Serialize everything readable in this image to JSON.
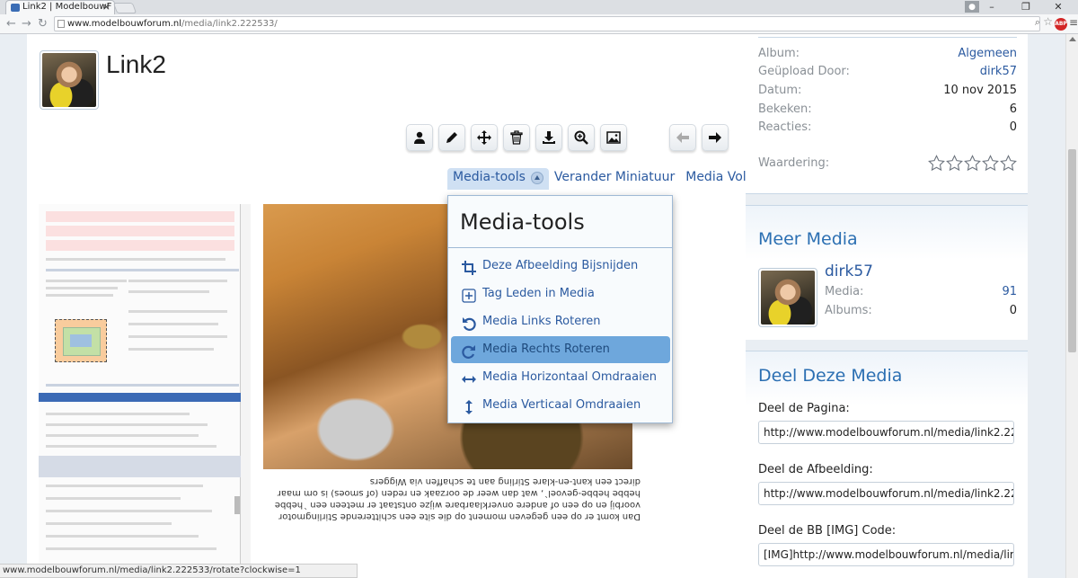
{
  "browser": {
    "tab_title": "Link2 | ModelbouwF",
    "url_host": "www.modelbouwforum.nl",
    "url_path": "/media/link2.222533/",
    "abp_label": "ABP",
    "status_url": "www.modelbouwforum.nl/media/link2.222533/rotate?clockwise=1"
  },
  "media": {
    "title": "Link2",
    "toolbar_icons": [
      "user-icon",
      "pencil-icon",
      "move-icon",
      "trash-icon",
      "download-icon",
      "zoom-icon",
      "image-icon",
      "arrow-left-icon",
      "arrow-right-icon"
    ],
    "tabs": {
      "media_tools": "Media-tools",
      "change_thumb": "Verander Miniatuur",
      "follow": "Media Volgen"
    },
    "photo_caption": "Dan komt er op een gegeven moment op die site een schitterende Stirlingmotor voorbij en op een of andere onverklaarbare wijze ontstaat er meteen een `hebbe hebbe hebbe-gevoel`, wat dan weer de oorzaak en reden (of smoes) is om maar direct een kant-en-klare Stirling aan te schaffen via Wiggers"
  },
  "dropdown": {
    "header": "Media-tools",
    "items": [
      {
        "label": "Deze Afbeelding Bijsnijden",
        "icon": "crop-icon"
      },
      {
        "label": "Tag Leden in Media",
        "icon": "tag-plus-icon"
      },
      {
        "label": "Media Links Roteren",
        "icon": "rotate-left-icon"
      },
      {
        "label": "Media Rechts Roteren",
        "icon": "rotate-right-icon"
      },
      {
        "label": "Media Horizontaal Omdraaien",
        "icon": "flip-horizontal-icon"
      },
      {
        "label": "Media Verticaal Omdraaien",
        "icon": "flip-vertical-icon"
      }
    ]
  },
  "info": {
    "album_label": "Album:",
    "album_value": "Algemeen",
    "uploaded_label": "Geüpload Door:",
    "uploaded_value": "dirk57",
    "date_label": "Datum:",
    "date_value": "10 nov 2015",
    "views_label": "Bekeken:",
    "views_value": "6",
    "reactions_label": "Reacties:",
    "reactions_value": "0",
    "rating_label": "Waardering:",
    "rating_stars": 0
  },
  "meer_media": {
    "heading": "Meer Media",
    "user": "dirk57",
    "media_label": "Media:",
    "media_value": "91",
    "albums_label": "Albums:",
    "albums_value": "0"
  },
  "share": {
    "heading": "Deel Deze Media",
    "page_label": "Deel de Pagina:",
    "page_value": "http://www.modelbouwforum.nl/media/link2.22",
    "image_label": "Deel de Afbeelding:",
    "image_value": "http://www.modelbouwforum.nl/media/link2.22",
    "bb_label": "Deel de BB [IMG] Code:",
    "bb_value": "[IMG]http://www.modelbouwforum.nl/media/lir"
  },
  "colors": {
    "link": "#2b5aa0",
    "heading_blue": "#2b6fb2",
    "highlight": "#6ea7dc"
  }
}
